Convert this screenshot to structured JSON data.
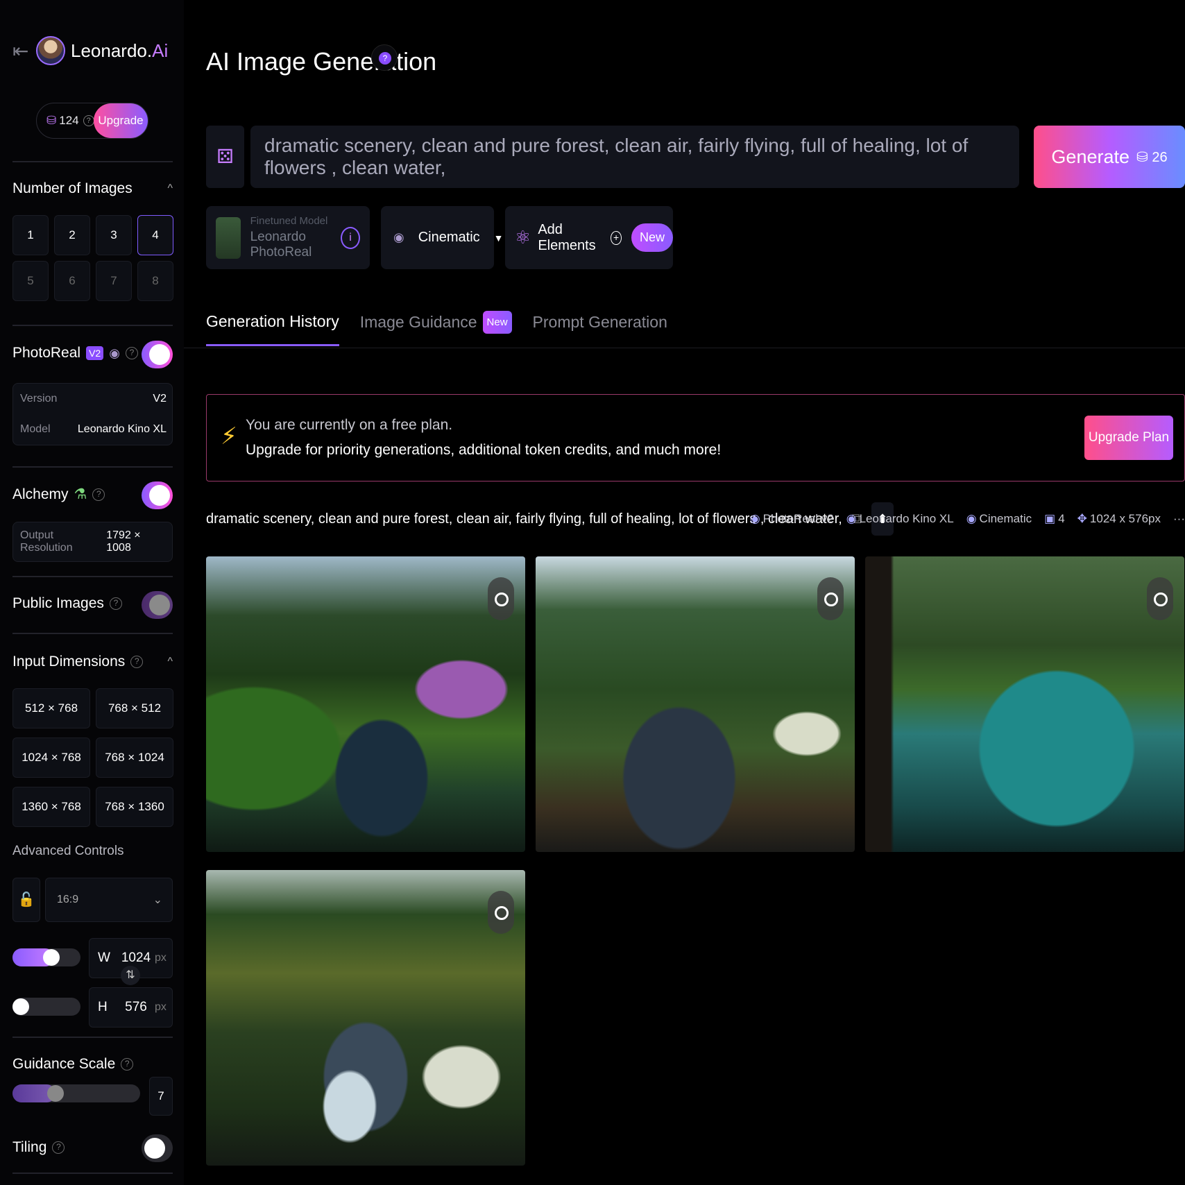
{
  "brand": {
    "name": "Leonardo.",
    "name_accent": "Ai",
    "back_icon": "collapse-sidebar-icon"
  },
  "account": {
    "tokens": "124",
    "upgrade_label": "Upgrade"
  },
  "number_of_images": {
    "title": "Number of Images",
    "options": [
      "1",
      "2",
      "3",
      "4",
      "5",
      "6",
      "7",
      "8"
    ],
    "selected": "4"
  },
  "photoreal": {
    "title": "PhotoReal",
    "badge": "V2",
    "enabled": true,
    "version_label": "Version",
    "version_value": "V2",
    "model_label": "Model",
    "model_value": "Leonardo Kino XL"
  },
  "alchemy": {
    "title": "Alchemy",
    "enabled": true,
    "output_label": "Output Resolution",
    "output_value": "1792 × 1008"
  },
  "public_images": {
    "title": "Public Images",
    "enabled": true
  },
  "input_dimensions": {
    "title": "Input Dimensions",
    "options": [
      "512 × 768",
      "768 × 512",
      "1024 × 768",
      "768 × 1024",
      "1360 × 768",
      "768 × 1360"
    ]
  },
  "advanced": {
    "title": "Advanced Controls",
    "aspect_ratio": "16:9",
    "width_label": "W",
    "width_value": "1024",
    "height_label": "H",
    "height_value": "576",
    "unit": "px"
  },
  "guidance": {
    "title": "Guidance Scale",
    "value": "7"
  },
  "tiling": {
    "title": "Tiling",
    "enabled": false
  },
  "header": {
    "title": "AI Image Generation"
  },
  "prompt": {
    "text": "dramatic scenery, clean and pure forest, clean air, fairly flying, full of healing, lot of flowers , clean water,",
    "generate_label": "Generate",
    "generate_cost": "26"
  },
  "toolbar": {
    "model_caption": "Finetuned Model",
    "model_name": "Leonardo PhotoReal",
    "style": "Cinematic",
    "elements_label": "Add Elements",
    "new_label": "New"
  },
  "tabs": [
    {
      "label": "Generation History",
      "active": true
    },
    {
      "label": "Image Guidance",
      "badge": "New"
    },
    {
      "label": "Prompt Generation"
    }
  ],
  "banner": {
    "line1": "You are currently on a free plan.",
    "line2": "Upgrade for priority generations, additional token credits, and much more!",
    "button": "Upgrade Plan"
  },
  "generation": {
    "prompt": "dramatic scenery, clean and pure forest, clean air, fairly flying, full of healing, lot of flowers , clean water,",
    "meta": [
      "PhotoReal v2",
      "Leonardo Kino XL",
      "Cinematic",
      "4",
      "1024 x 576px"
    ],
    "more": "···"
  }
}
